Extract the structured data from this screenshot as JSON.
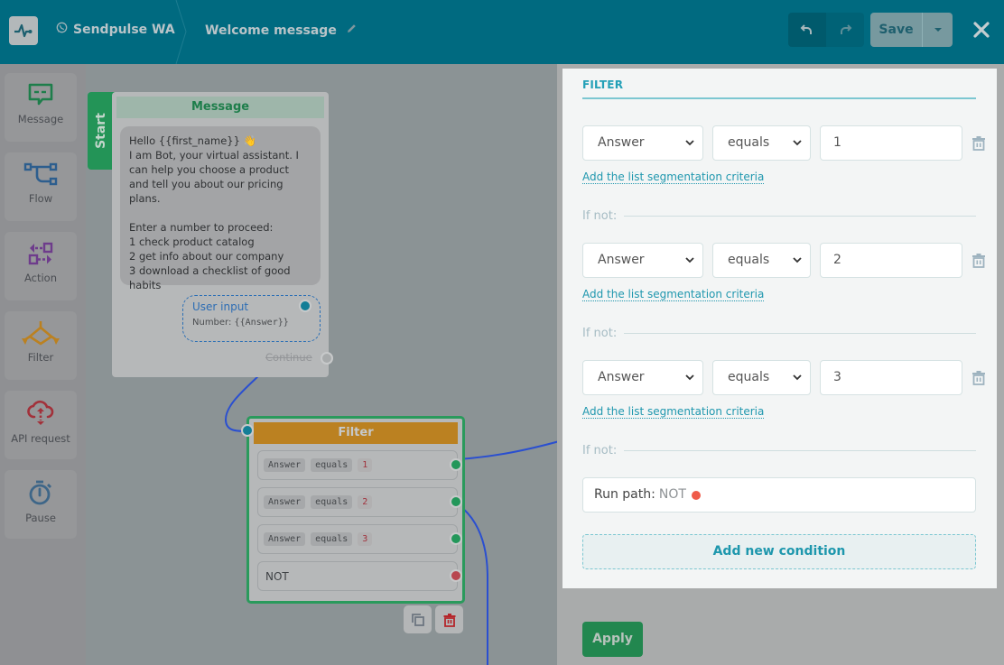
{
  "header": {
    "app_name": "Sendpulse WA",
    "flow_title": "Welcome message",
    "save_label": "Save",
    "icons": {
      "logo": "pulse-logo-icon",
      "channel": "whatsapp-icon",
      "edit": "pencil-icon",
      "undo": "undo-icon",
      "redo": "redo-icon",
      "save_menu": "caret-down-icon",
      "close": "close-icon"
    }
  },
  "sidebar": {
    "items": [
      {
        "label": "Message",
        "icon": "message-icon",
        "color": "#1e7e4b"
      },
      {
        "label": "Flow",
        "icon": "flow-icon",
        "color": "#2d5e8e"
      },
      {
        "label": "Action",
        "icon": "action-icon",
        "color": "#6e3c8c"
      },
      {
        "label": "Filter",
        "icon": "filter-icon",
        "color": "#bb8121"
      },
      {
        "label": "API request",
        "icon": "cloud-api-icon",
        "color": "#a2313a"
      },
      {
        "label": "Pause",
        "icon": "stopwatch-icon",
        "color": "#3e6688"
      }
    ]
  },
  "canvas": {
    "start_label": "Start",
    "message_node": {
      "title": "Message",
      "text": "Hello {{first_name}} 👋\nI am Bot, your virtual assistant. I can help you choose a product and tell you about our pricing plans.\n\nEnter a number to proceed:\n1 check product catalog\n2 get info about our company\n3 download a checklist of good habits",
      "user_input_title": "User input",
      "user_input_prefix": "Number: ",
      "user_input_var": "{{Answer}}",
      "continue_label": "Continue"
    },
    "filter_node": {
      "title": "Filter",
      "rows": [
        {
          "field": "Answer",
          "op": "equals",
          "value": "1"
        },
        {
          "field": "Answer",
          "op": "equals",
          "value": "2"
        },
        {
          "field": "Answer",
          "op": "equals",
          "value": "3"
        }
      ],
      "else_label": "NOT",
      "actions": [
        "copy-icon",
        "trash-icon"
      ]
    }
  },
  "panel": {
    "title": "FILTER",
    "conditions": [
      {
        "field": "Answer",
        "operator": "equals",
        "value": "1",
        "link": "Add the list segmentation criteria"
      },
      {
        "field": "Answer",
        "operator": "equals",
        "value": "2",
        "link": "Add the list segmentation criteria"
      },
      {
        "field": "Answer",
        "operator": "equals",
        "value": "3",
        "link": "Add the list segmentation criteria"
      }
    ],
    "if_not_label": "If not:",
    "run_path_label": "Run path:",
    "run_path_value": "NOT",
    "add_condition_label": "Add new condition",
    "apply_label": "Apply"
  },
  "colors": {
    "header_bg": "#006a80",
    "accent": "#23a0b7",
    "success": "#22874f",
    "filter_orange": "#bb8121",
    "not_dot": "#ef5b4a"
  }
}
